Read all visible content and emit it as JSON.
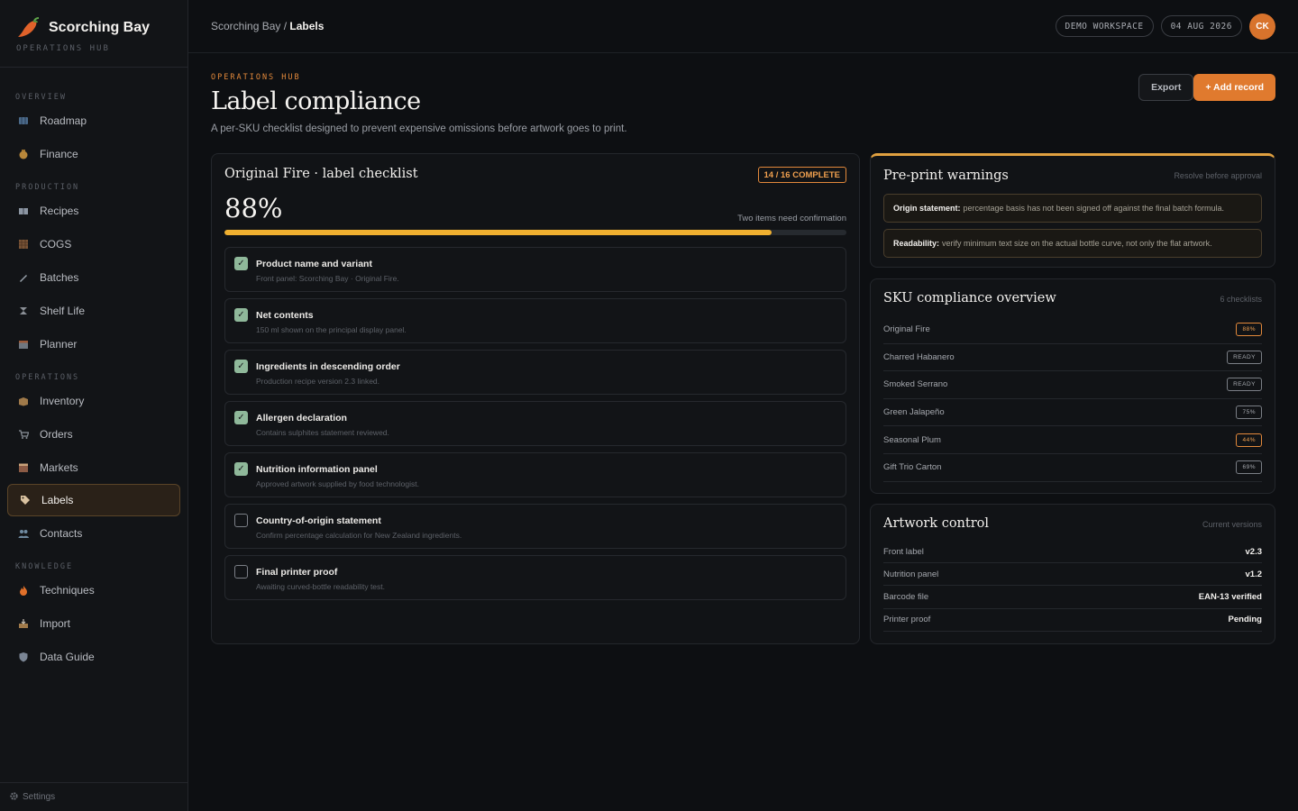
{
  "brand": {
    "name": "Scorching Bay",
    "subtitle": "OPERATIONS HUB"
  },
  "sidebar": {
    "sections": [
      {
        "label": "OVERVIEW",
        "items": [
          {
            "label": "Roadmap",
            "icon": "map-icon"
          },
          {
            "label": "Finance",
            "icon": "money-bag-icon"
          }
        ]
      },
      {
        "label": "PRODUCTION",
        "items": [
          {
            "label": "Recipes",
            "icon": "book-icon"
          },
          {
            "label": "COGS",
            "icon": "ledger-icon"
          },
          {
            "label": "Batches",
            "icon": "pen-icon"
          },
          {
            "label": "Shelf Life",
            "icon": "hourglass-icon"
          },
          {
            "label": "Planner",
            "icon": "calendar-icon"
          }
        ]
      },
      {
        "label": "OPERATIONS",
        "items": [
          {
            "label": "Inventory",
            "icon": "box-icon"
          },
          {
            "label": "Orders",
            "icon": "cart-icon"
          },
          {
            "label": "Markets",
            "icon": "market-icon"
          },
          {
            "label": "Labels",
            "icon": "tag-icon",
            "active": true
          },
          {
            "label": "Contacts",
            "icon": "people-icon"
          }
        ]
      },
      {
        "label": "KNOWLEDGE",
        "items": [
          {
            "label": "Techniques",
            "icon": "flame-icon"
          },
          {
            "label": "Import",
            "icon": "inbox-icon"
          },
          {
            "label": "Data Guide",
            "icon": "shield-icon"
          }
        ]
      }
    ],
    "footer": "Settings"
  },
  "topbar": {
    "breadcrumb_root": "Scorching Bay",
    "breadcrumb_sep": " / ",
    "breadcrumb_current": "Labels",
    "workspace": "DEMO WORKSPACE",
    "date": "04 AUG 2026",
    "avatar_initials": "CK"
  },
  "page": {
    "eyebrow": "OPERATIONS HUB",
    "title": "Label compliance",
    "description": "A per-SKU checklist designed to prevent expensive omissions before artwork goes to print.",
    "export_label": "Export",
    "add_label": "+ Add record"
  },
  "checklist": {
    "title": "Original Fire · label checklist",
    "badge": "14 / 16 COMPLETE",
    "percent_text": "88%",
    "progress": 0.88,
    "note": "Two items need confirmation",
    "items": [
      {
        "title": "Product name and variant",
        "sub": "Front panel: Scorching Bay · Original Fire.",
        "checked": true
      },
      {
        "title": "Net contents",
        "sub": "150 ml shown on the principal display panel.",
        "checked": true
      },
      {
        "title": "Ingredients in descending order",
        "sub": "Production recipe version 2.3 linked.",
        "checked": true
      },
      {
        "title": "Allergen declaration",
        "sub": "Contains sulphites statement reviewed.",
        "checked": true
      },
      {
        "title": "Nutrition information panel",
        "sub": "Approved artwork supplied by food technologist.",
        "checked": true
      },
      {
        "title": "Country-of-origin statement",
        "sub": "Confirm percentage calculation for New Zealand ingredients.",
        "checked": false
      },
      {
        "title": "Final printer proof",
        "sub": "Awaiting curved-bottle readability test.",
        "checked": false
      }
    ]
  },
  "warnings": {
    "title": "Pre-print warnings",
    "meta": "Resolve before approval",
    "items": [
      {
        "label": "Origin statement:",
        "text": "percentage basis has not been signed off against the final batch formula."
      },
      {
        "label": "Readability:",
        "text": "verify minimum text size on the actual bottle curve, not only the flat artwork."
      }
    ]
  },
  "sku": {
    "title": "SKU compliance overview",
    "meta": "6 checklists",
    "rows": [
      {
        "name": "Original Fire",
        "status": "88%",
        "warn": true
      },
      {
        "name": "Charred Habanero",
        "status": "READY",
        "warn": false
      },
      {
        "name": "Smoked Serrano",
        "status": "READY",
        "warn": false
      },
      {
        "name": "Green Jalapeño",
        "status": "75%",
        "warn": false
      },
      {
        "name": "Seasonal Plum",
        "status": "44%",
        "warn": true
      },
      {
        "name": "Gift Trio Carton",
        "status": "69%",
        "warn": false
      }
    ]
  },
  "artwork": {
    "title": "Artwork control",
    "meta": "Current versions",
    "rows": [
      {
        "name": "Front label",
        "value": "v2.3"
      },
      {
        "name": "Nutrition panel",
        "value": "v1.2"
      },
      {
        "name": "Barcode file",
        "value": "EAN-13 verified"
      },
      {
        "name": "Printer proof",
        "value": "Pending"
      }
    ]
  },
  "colors": {
    "accent": "#e07a2e",
    "progress": "#f0b030",
    "check": "#8fb89a"
  }
}
